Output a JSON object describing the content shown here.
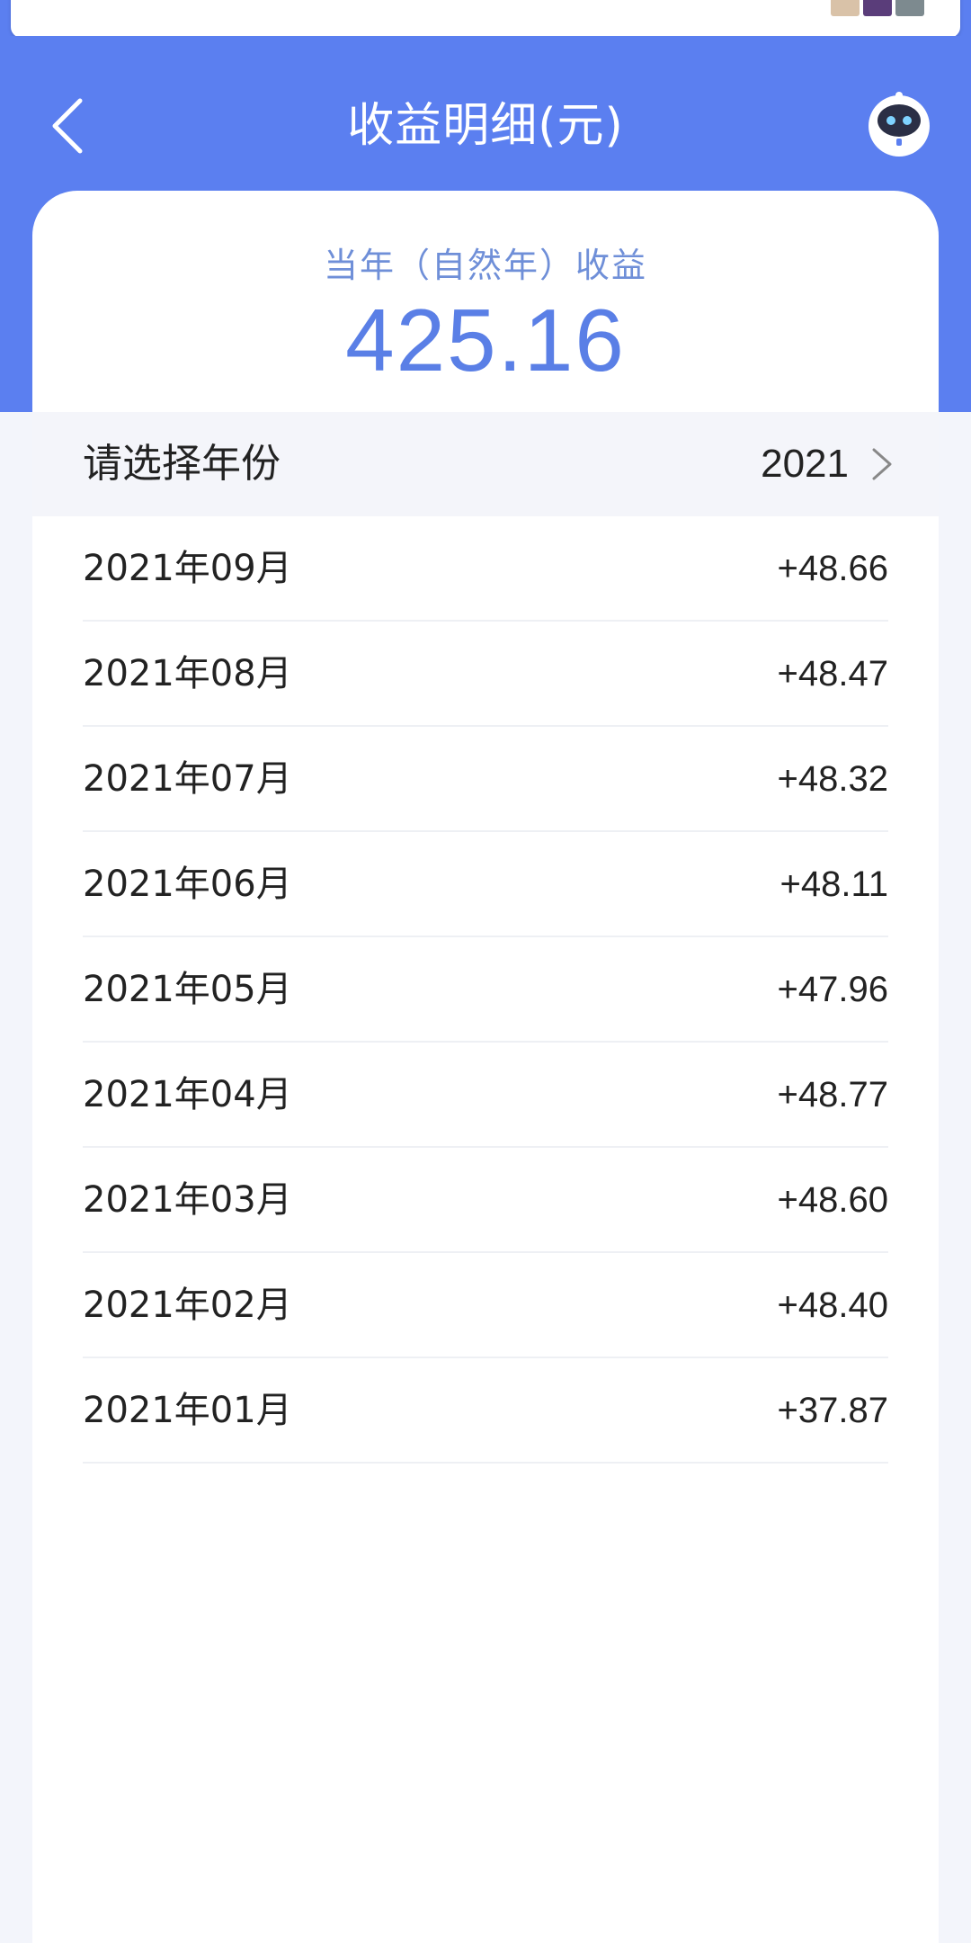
{
  "colors": {
    "brand_blue": "#5b7ff0",
    "summary_text": "#5a7fe6",
    "text": "#222222",
    "divider": "#eef0f4",
    "selector_bg": "#f4f5fa"
  },
  "header": {
    "title": "收益明细(元)",
    "back_icon": "chevron-left-icon",
    "assistant_icon": "robot-icon"
  },
  "summary": {
    "label": "当年（自然年）收益",
    "value": "425.16"
  },
  "year_selector": {
    "label": "请选择年份",
    "value": "2021",
    "chevron_icon": "chevron-right-icon"
  },
  "monthly_earnings": [
    {
      "month": "2021年09月",
      "amount": "+48.66"
    },
    {
      "month": "2021年08月",
      "amount": "+48.47"
    },
    {
      "month": "2021年07月",
      "amount": "+48.32"
    },
    {
      "month": "2021年06月",
      "amount": "+48.11"
    },
    {
      "month": "2021年05月",
      "amount": "+47.96"
    },
    {
      "month": "2021年04月",
      "amount": "+48.77"
    },
    {
      "month": "2021年03月",
      "amount": "+48.60"
    },
    {
      "month": "2021年02月",
      "amount": "+48.40"
    },
    {
      "month": "2021年01月",
      "amount": "+37.87"
    }
  ]
}
